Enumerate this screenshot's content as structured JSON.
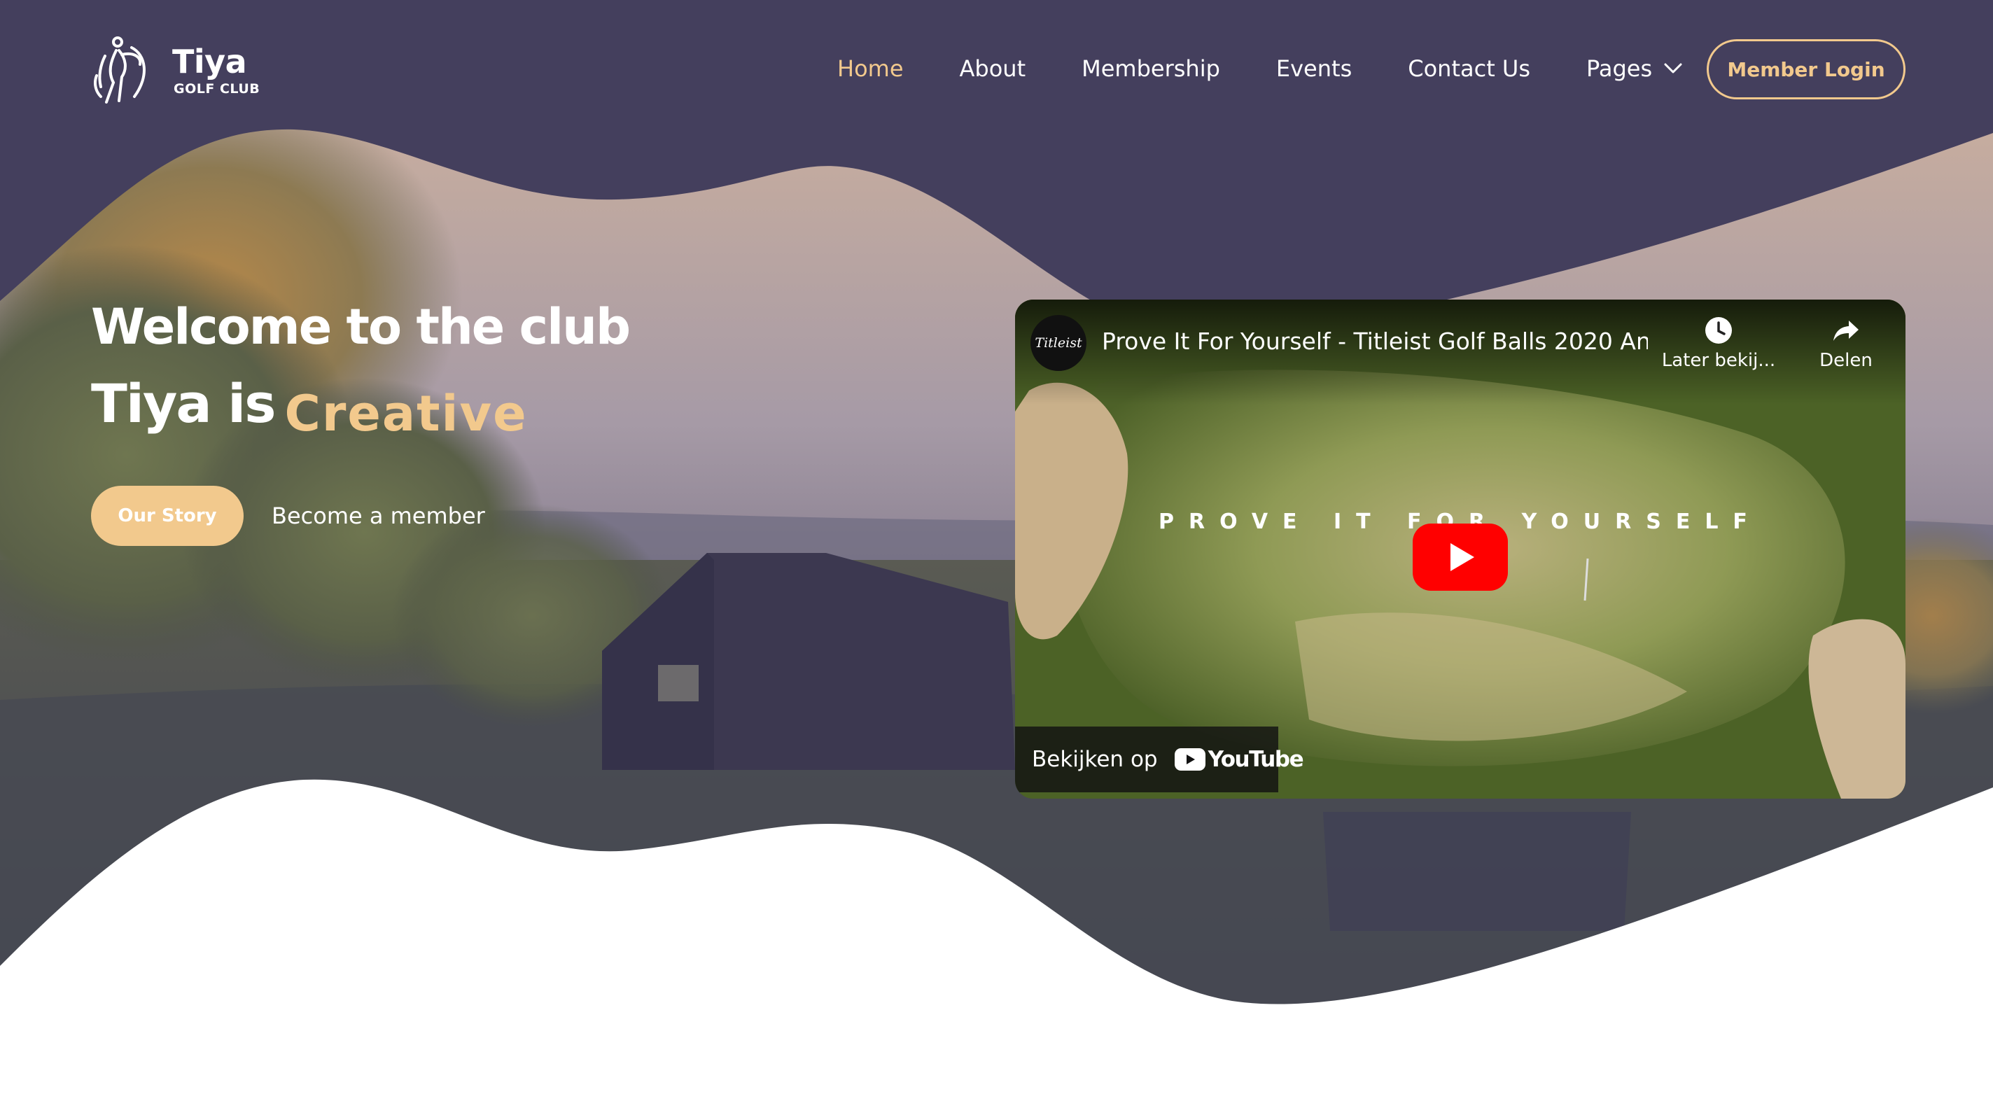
{
  "brand": {
    "name": "Tiya",
    "subtitle": "GOLF CLUB"
  },
  "nav": {
    "items": [
      {
        "label": "Home",
        "active": true
      },
      {
        "label": "About"
      },
      {
        "label": "Membership"
      },
      {
        "label": "Events"
      },
      {
        "label": "Contact Us"
      },
      {
        "label": "Pages",
        "has_dropdown": true
      }
    ],
    "login_label": "Member Login"
  },
  "hero": {
    "title": "Welcome to the club",
    "subtitle_main": "Tiya is",
    "subtitle_accent": "Creative",
    "primary_button": "Our Story",
    "secondary_link": "Become a member"
  },
  "video": {
    "channel": "Titleist",
    "title": "Prove It For Yourself - Titleist Golf Balls 2020 An...",
    "watch_later_label": "Later bekij...",
    "share_label": "Delen",
    "banner_text": "PROVE IT FOR YOURSELF",
    "watch_on_label": "Bekijken op",
    "youtube_word": "YouTube"
  },
  "colors": {
    "header_bg": "#443f5d",
    "accent": "#f2c98d",
    "text_light": "#ffffff",
    "youtube_red": "#ff0000"
  }
}
